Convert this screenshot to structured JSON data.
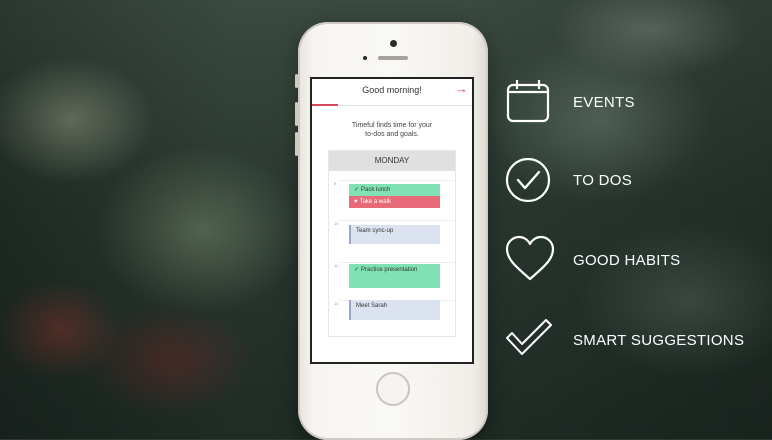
{
  "screen": {
    "header_title": "Good morning!",
    "intro_line1": "Timeful finds time for your",
    "intro_line2": "to-dos and goals.",
    "day": "MONDAY",
    "hours": [
      "9",
      "10",
      "11",
      "12"
    ],
    "events": [
      {
        "label": "Pack lunch",
        "type": "todo",
        "color": "#7fe1b4"
      },
      {
        "label": "Take a walk",
        "type": "habit",
        "color": "#e86b7a"
      },
      {
        "label": "Team sync-up",
        "type": "event",
        "color": "#dce3f0"
      },
      {
        "label": "Practice presentation",
        "type": "todo",
        "color": "#7fe1b4"
      },
      {
        "label": "Meet Sarah",
        "type": "event",
        "color": "#dce3f0"
      }
    ],
    "accent_color": "#d6495c"
  },
  "features": [
    {
      "label": "EVENTS",
      "icon": "calendar-icon"
    },
    {
      "label": "TO DOS",
      "icon": "check-circle-icon"
    },
    {
      "label": "GOOD HABITS",
      "icon": "heart-icon"
    },
    {
      "label": "SMART SUGGESTIONS",
      "icon": "checkmark-icon"
    }
  ]
}
